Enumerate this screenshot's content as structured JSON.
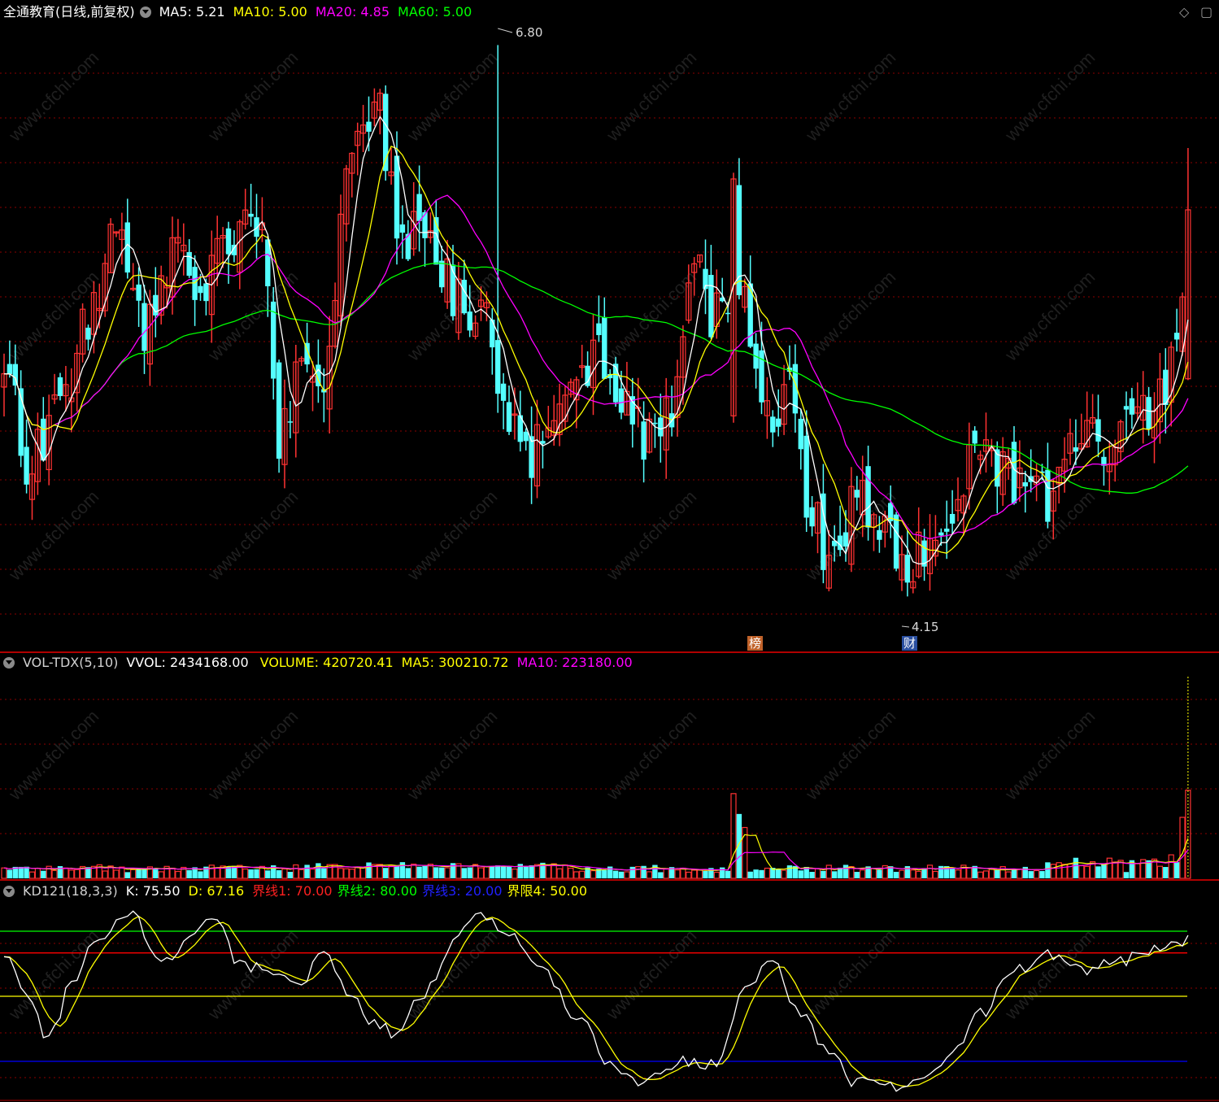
{
  "header": {
    "stock_title": "全通教育(日线,前复权)",
    "ma": [
      {
        "label": "MA5: 5.21",
        "color": "#ffffff"
      },
      {
        "label": "MA10: 5.00",
        "color": "#ffff00"
      },
      {
        "label": "MA20: 4.85",
        "color": "#ff00ff"
      },
      {
        "label": "MA60: 5.00",
        "color": "#00ff00"
      }
    ],
    "icons": [
      "diamond-icon",
      "restore-window-icon"
    ]
  },
  "vol_header": {
    "name": "VOL-TDX(5,10)",
    "vvol": "VVOL: 2434168.00",
    "volume": "VOLUME: 420720.41",
    "ma5": "MA5: 300210.72",
    "ma10": "MA10: 223180.00"
  },
  "kd_header": {
    "name": "KD121(18,3,3)",
    "k": "K: 75.50",
    "d": "D: 67.16",
    "l1": "界线1: 70.00",
    "l2": "界线2: 80.00",
    "l3": "界线3: 20.00",
    "l4": "界限4: 50.00"
  },
  "markers": {
    "high": "6.80",
    "low": "4.15",
    "tag_bang": "榜",
    "tag_cai": "财"
  },
  "watermark": "www.cfchi.com",
  "colors": {
    "up": "#ff3232",
    "down": "#54ffff",
    "ma5": "#ffffff",
    "ma10": "#ffff00",
    "ma20": "#ff00ff",
    "ma60": "#00ff00",
    "grid": "#8b0000",
    "k": "#ffffff",
    "d": "#ffff00",
    "line70": "#ff0000",
    "line80": "#00ff00",
    "line20": "#0000ff",
    "line50": "#ffff00"
  },
  "chart_data": [
    {
      "type": "candlestick",
      "title": "全通教育(日线,前复权)",
      "anchors": [
        [
          0,
          5.3
        ],
        [
          4,
          4.8
        ],
        [
          10,
          5.0
        ],
        [
          15,
          5.5
        ],
        [
          21,
          5.9
        ],
        [
          25,
          5.4
        ],
        [
          31,
          5.8
        ],
        [
          35,
          5.6
        ],
        [
          40,
          5.9
        ],
        [
          46,
          5.95
        ],
        [
          49,
          4.9
        ],
        [
          53,
          5.3
        ],
        [
          57,
          5.2
        ],
        [
          62,
          6.3
        ],
        [
          66,
          6.5
        ],
        [
          71,
          5.9
        ],
        [
          76,
          5.8
        ],
        [
          81,
          5.55
        ],
        [
          86,
          5.45
        ],
        [
          89,
          5.0
        ],
        [
          93,
          4.8
        ],
        [
          97,
          5.0
        ],
        [
          100,
          5.1
        ],
        [
          105,
          5.3
        ],
        [
          110,
          5.0
        ],
        [
          114,
          4.9
        ],
        [
          118,
          4.95
        ],
        [
          123,
          5.8
        ],
        [
          126,
          5.5
        ],
        [
          131,
          5.7
        ],
        [
          135,
          5.0
        ],
        [
          140,
          5.1
        ],
        [
          143,
          4.6
        ],
        [
          148,
          4.25
        ],
        [
          152,
          4.6
        ],
        [
          157,
          4.4
        ],
        [
          163,
          4.3
        ],
        [
          168,
          4.55
        ],
        [
          174,
          4.8
        ],
        [
          179,
          4.7
        ],
        [
          186,
          4.6
        ],
        [
          191,
          4.9
        ],
        [
          197,
          4.85
        ],
        [
          202,
          4.95
        ],
        [
          206,
          5.1
        ],
        [
          211,
          5.5
        ]
      ],
      "high_label": 6.8,
      "low_label": 4.15,
      "ma5_last": 5.21,
      "ma10_last": 5.0,
      "ma20_last": 4.85,
      "ma60_last": 5.0
    },
    {
      "type": "bar",
      "title": "VOL-TDX(5,10)",
      "last_volume": 420720.41,
      "ma5": 300210.72,
      "ma10": 223180.0,
      "vvol": 2434168.0,
      "spikes": [
        [
          130,
          2.5
        ],
        [
          131,
          1.9
        ],
        [
          132,
          1.5
        ],
        [
          210,
          1.8
        ],
        [
          211,
          2.6
        ]
      ]
    },
    {
      "type": "line",
      "title": "KD121(18,3,3)",
      "ylim": [
        0,
        100
      ],
      "k_last": 75.5,
      "d_last": 67.16,
      "levels": [
        70,
        80,
        20,
        50
      ],
      "k_anchors": [
        [
          0,
          70
        ],
        [
          4,
          52
        ],
        [
          8,
          30
        ],
        [
          12,
          55
        ],
        [
          16,
          75
        ],
        [
          23,
          88
        ],
        [
          28,
          65
        ],
        [
          34,
          80
        ],
        [
          38,
          85
        ],
        [
          42,
          65
        ],
        [
          48,
          60
        ],
        [
          53,
          58
        ],
        [
          57,
          70
        ],
        [
          62,
          48
        ],
        [
          66,
          38
        ],
        [
          70,
          33
        ],
        [
          75,
          52
        ],
        [
          80,
          75
        ],
        [
          85,
          88
        ],
        [
          90,
          78
        ],
        [
          96,
          62
        ],
        [
          102,
          40
        ],
        [
          108,
          20
        ],
        [
          112,
          10
        ],
        [
          116,
          15
        ],
        [
          122,
          20
        ],
        [
          127,
          18
        ],
        [
          132,
          55
        ],
        [
          137,
          65
        ],
        [
          141,
          45
        ],
        [
          147,
          25
        ],
        [
          152,
          10
        ],
        [
          157,
          8
        ],
        [
          163,
          10
        ],
        [
          168,
          20
        ],
        [
          174,
          42
        ],
        [
          180,
          62
        ],
        [
          186,
          70
        ],
        [
          192,
          62
        ],
        [
          197,
          65
        ],
        [
          202,
          68
        ],
        [
          207,
          72
        ],
        [
          211,
          76
        ]
      ]
    }
  ]
}
